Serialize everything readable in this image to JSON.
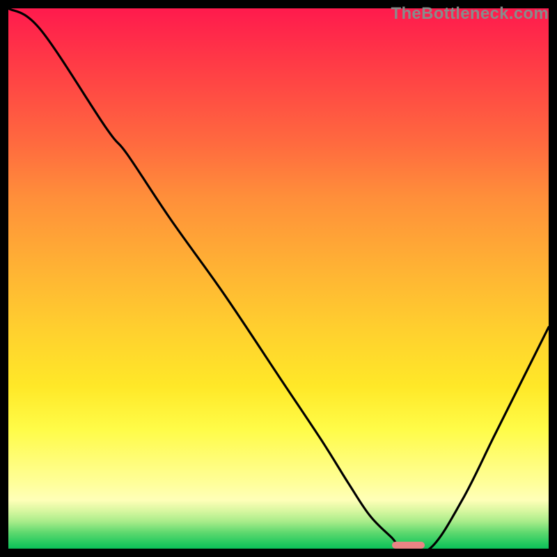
{
  "watermark": "TheBottleneck.com",
  "chart_data": {
    "type": "line",
    "title": "",
    "xlabel": "",
    "ylabel": "",
    "xlim": [
      0,
      100
    ],
    "ylim": [
      0,
      100
    ],
    "series": [
      {
        "name": "bottleneck-curve",
        "x": [
          0,
          6,
          18,
          22,
          30,
          40,
          50,
          58,
          63,
          67,
          71,
          73,
          78,
          84,
          90,
          96,
          100
        ],
        "values": [
          100,
          96,
          78,
          73,
          61,
          47,
          32,
          20,
          12,
          6,
          2,
          0,
          0,
          9,
          21,
          33,
          41
        ]
      }
    ],
    "annotations": [
      {
        "name": "sweet-spot-marker",
        "x_start": 71,
        "x_end": 77,
        "y": 0
      }
    ]
  },
  "colors": {
    "curve": "#000000",
    "marker": "#e98484"
  }
}
